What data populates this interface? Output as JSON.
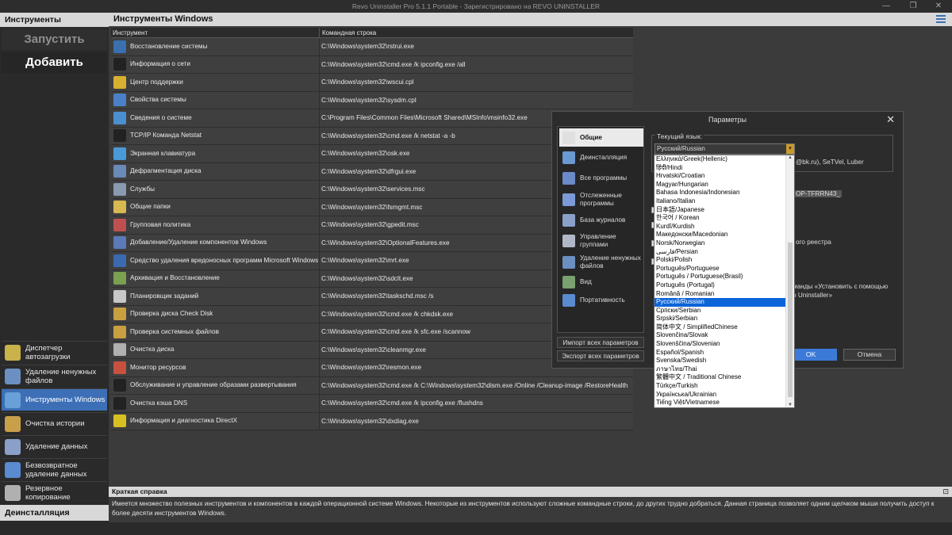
{
  "window": {
    "title": "Revo Uninstaller Pro 5.1.1 Portable - Зарегистрировано на REVO UNINSTALLER",
    "min": "—",
    "max": "❐",
    "close": "✕"
  },
  "left": {
    "header": "Инструменты",
    "run": "Запустить",
    "add": "Добавить",
    "nav": [
      {
        "label": "Диспетчер автозагрузки",
        "color": "#c9b24a"
      },
      {
        "label": "Удаление ненужных файлов",
        "color": "#6b8fc0"
      },
      {
        "label": "Инструменты Windows",
        "color": "#6aa0d8"
      },
      {
        "label": "Очистка истории",
        "color": "#c9a04a"
      },
      {
        "label": "Удаление данных",
        "color": "#8aa0c8"
      },
      {
        "label": "Безвозвратное удаление данных",
        "color": "#5a8ad0"
      },
      {
        "label": "Резервное копирование",
        "color": "#b0b0b0"
      }
    ],
    "footer": "Деинсталляция"
  },
  "main": {
    "title": "Инструменты Windows",
    "col_tool": "Инструмент",
    "col_cmd": "Командная строка",
    "rows": [
      {
        "name": "Восстановление системы",
        "cmd": "C:\\Windows\\system32\\rstrui.exe",
        "color": "#3a6fb0"
      },
      {
        "name": "Информация о сети",
        "cmd": "C:\\Windows\\system32\\cmd.exe /k ipconfig.exe /all",
        "color": "#222222"
      },
      {
        "name": "Центр поддержки",
        "cmd": "C:\\Windows\\system32\\wscui.cpl",
        "color": "#d8b030"
      },
      {
        "name": "Свойства системы",
        "cmd": "C:\\Windows\\system32\\sysdm.cpl",
        "color": "#4a80c8"
      },
      {
        "name": "Сведения о системе",
        "cmd": "C:\\Program Files\\Common Files\\Microsoft Shared\\MSInfo\\msinfo32.exe",
        "color": "#4a90d0"
      },
      {
        "name": "TCP/IP Команда Netstat",
        "cmd": "C:\\Windows\\system32\\cmd.exe /k netstat -a -b",
        "color": "#222222"
      },
      {
        "name": "Экранная клавиатура",
        "cmd": "C:\\Windows\\system32\\osk.exe",
        "color": "#4a9ad8"
      },
      {
        "name": "Дефрагментация диска",
        "cmd": "C:\\Windows\\system32\\dfrgui.exe",
        "color": "#6a8ab8"
      },
      {
        "name": "Службы",
        "cmd": "C:\\Windows\\system32\\services.msc",
        "color": "#8a9ab0"
      },
      {
        "name": "Общие папки",
        "cmd": "C:\\Windows\\system32\\fsmgmt.msc",
        "color": "#d8b850"
      },
      {
        "name": "Групповая политика",
        "cmd": "C:\\Windows\\system32\\gpedit.msc",
        "color": "#c05050"
      },
      {
        "name": "Добавление/Удаление компонентов Windows",
        "cmd": "C:\\Windows\\system32\\OptionalFeatures.exe",
        "color": "#5a7ab8"
      },
      {
        "name": "Средство удаления вредоносных программ Microsoft Windows",
        "cmd": "C:\\Windows\\system32\\mrt.exe",
        "color": "#3a6ab0"
      },
      {
        "name": "Архивация и Восстановление",
        "cmd": "C:\\Windows\\system32\\sdclt.exe",
        "color": "#7aa050"
      },
      {
        "name": "Планировщик заданий",
        "cmd": "C:\\Windows\\system32\\taskschd.msc /s",
        "color": "#c8c8c8"
      },
      {
        "name": "Проверка диска Check Disk",
        "cmd": "C:\\Windows\\system32\\cmd.exe /k chkdsk.exe",
        "color": "#c8a040"
      },
      {
        "name": "Проверка системных файлов",
        "cmd": "C:\\Windows\\system32\\cmd.exe /k sfc.exe /scannow",
        "color": "#c8a040"
      },
      {
        "name": "Очистка диска",
        "cmd": "C:\\Windows\\system32\\cleanmgr.exe",
        "color": "#b0b0b0"
      },
      {
        "name": "Монитор ресурсов",
        "cmd": "C:\\Windows\\system32\\resmon.exe",
        "color": "#c85040"
      },
      {
        "name": "Обслуживание и управление образами развертывания",
        "cmd": "C:\\Windows\\system32\\cmd.exe  /k C:\\Windows\\system32\\dism.exe /Online /Cleanup-image /RestoreHealth",
        "color": "#222222"
      },
      {
        "name": "Очистка кэша DNS",
        "cmd": "C:\\Windows\\system32\\cmd.exe /k ipconfig.exe /flushdns",
        "color": "#222222"
      },
      {
        "name": "Информация и диагностика DirectX",
        "cmd": "C:\\Windows\\system32\\dxdiag.exe",
        "color": "#d8c020"
      }
    ]
  },
  "help": {
    "title": "Краткая справка",
    "text": "Имеется множество полезных инструментов и компонентов в каждой операционной системе Windows. Некоторые из инструментов используют сложные командные строки, до других трудно добраться. Данная страница позволяет одним щелчком мыши получить доступ к более десяти инструментов Windows."
  },
  "dialog": {
    "title": "Параметры",
    "nav": [
      {
        "label": "Общие",
        "color": "#e0e0e0"
      },
      {
        "label": "Деинсталляция",
        "color": "#6a9ad0"
      },
      {
        "label": "Все программы",
        "color": "#6a8ac8"
      },
      {
        "label": "Отслеженные программы",
        "color": "#7a9ad8"
      },
      {
        "label": "База журналов",
        "color": "#8aa0c8"
      },
      {
        "label": "Управление группами",
        "color": "#b0b8c8"
      },
      {
        "label": "Удаление ненужных файлов",
        "color": "#6b8fc0"
      },
      {
        "label": "Вид",
        "color": "#7aa070"
      },
      {
        "label": "Портативность",
        "color": "#5a8ad0"
      }
    ],
    "import": "Импорт всех параметров",
    "export": "Экспорт всех параметров",
    "lang_label": "Текущий язык:",
    "lang_value": "Русский/Russian",
    "thanks_fragment": "@bk.ru), SeTVel, Luber",
    "pc_name_fragment": "OP-TFRRN43_",
    "registry_fragment": "ого реестра",
    "cmd_fragment": "манды «Установить с помощью",
    "cmd_fragment2": "o Uninstaller»",
    "ok": "OK",
    "cancel": "Отмена",
    "languages": [
      "Ελληνικά/Greek(Hellenic)",
      "हिंदी/Hindi",
      "Hrvatski/Croatian",
      "Magyar/Hungarian",
      "Bahasa Indonesia/Indonesian",
      "Italiano/Italian",
      "日本語/Japanese",
      "한국어 / Korean",
      "Kurdî/Kurdish",
      "Македонски/Macedonian",
      "Norsk/Norwegian",
      "فارسی/Persian",
      "Polski/Polish",
      "Português/Portuguese",
      "Português / Portuguese(Brasil)",
      "Português (Portugal)",
      "Română / Romanian",
      "Русский/Russian",
      "Српски/Serbian",
      "Srpski/Serbian",
      "简体中文 / SimplifiedChinese",
      "Slovenčina/Slovak",
      "Slovenščina/Slovenian",
      "Español/Spanish",
      "Svenska/Swedish",
      "ภาษาไทย/Thai",
      "繁體中文 / Traditional Chinese",
      "Türkçe/Turkish",
      "Українська/Ukrainian",
      "Tiếng Việt/Vietnamese"
    ],
    "selected_language_index": 17
  }
}
